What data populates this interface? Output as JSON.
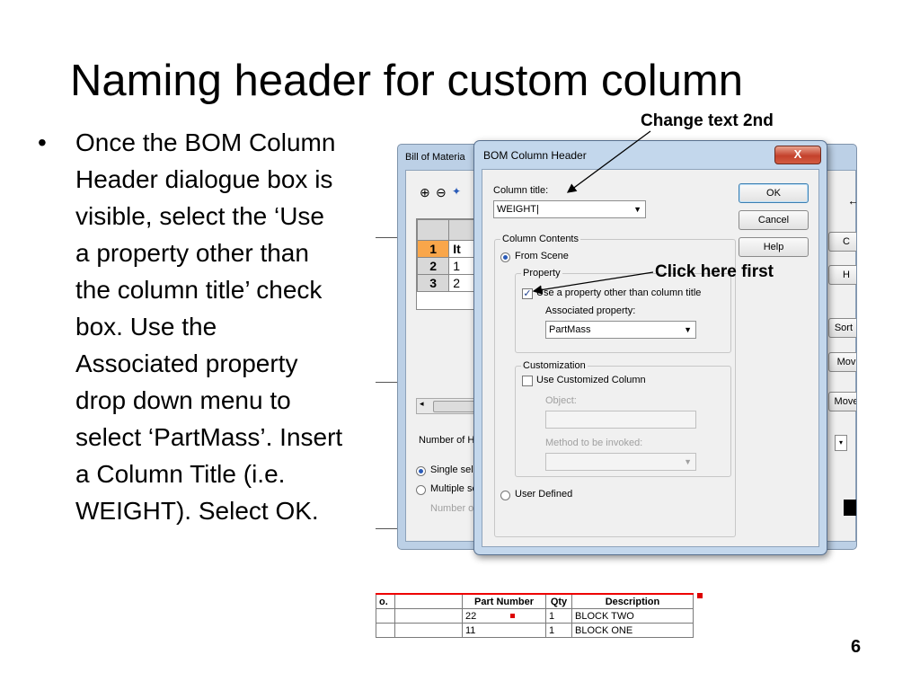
{
  "slide": {
    "title": "Naming header for custom column",
    "bullet_char": "•",
    "bullet_text": "Once the BOM Column Header dialogue box is visible, select the ‘Use a property other than the column title’ check box. Use the Associated property drop down menu to select ‘PartMass’. Insert a Column Title (i.e. WEIGHT). Select OK.",
    "page_number": "6"
  },
  "callouts": {
    "change_text": "Change text 2nd",
    "click_here": "Click here first"
  },
  "bom_window": {
    "title": "Bill of Materia",
    "rows": [
      {
        "num": "1",
        "val": "It"
      },
      {
        "num": "2",
        "val": "1"
      },
      {
        "num": "3",
        "val": "2"
      }
    ],
    "number_of_h": "Number of H",
    "single_sel": "Single sel",
    "multiple_sel": "Multiple se",
    "number_of": "Number of",
    "right_buttons": [
      "C",
      "H",
      "Sort I",
      "Mov",
      "Move"
    ]
  },
  "dialog": {
    "title": "BOM Column Header",
    "close_glyph": "X",
    "column_title_label": "Column title:",
    "column_title_value": "WEIGHT|",
    "ok": "OK",
    "cancel": "Cancel",
    "help": "Help",
    "column_contents_label": "Column Contents",
    "from_scene": "From Scene",
    "property_label": "Property",
    "use_property": "Use a property other than column title",
    "associated_label": "Associated property:",
    "associated_value": "PartMass",
    "customization_label": "Customization",
    "use_customized": "Use Customized Column",
    "object_label": "Object:",
    "method_label": "Method to be invoked:",
    "user_defined": "User Defined"
  },
  "strip_table": {
    "headers": [
      "o.",
      "",
      "Part Number",
      "Qty",
      "Description"
    ],
    "rows": [
      [
        "",
        "",
        "22",
        "1",
        "BLOCK TWO"
      ],
      [
        "",
        "",
        "11",
        "1",
        "BLOCK ONE"
      ]
    ]
  },
  "colors": {
    "accent_orange": "#f9a64a",
    "arrow_black": "#000000",
    "close_red": "#c4412c"
  }
}
